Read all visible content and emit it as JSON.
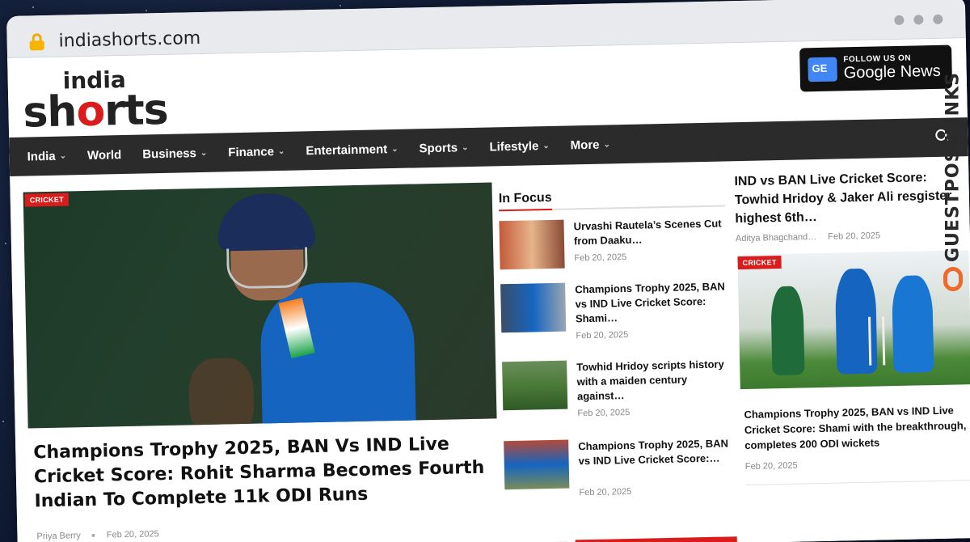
{
  "browser": {
    "url": "indiashorts.com"
  },
  "site": {
    "logo_small": "india",
    "logo_big_pre": "sh",
    "logo_big_red": "o",
    "logo_big_post": "rts",
    "google_news_follow": "FOLLOW US ON",
    "google_news_label": "Google News"
  },
  "nav": {
    "items": [
      {
        "label": "India",
        "caret": true
      },
      {
        "label": "World",
        "caret": false
      },
      {
        "label": "Business",
        "caret": true
      },
      {
        "label": "Finance",
        "caret": true
      },
      {
        "label": "Entertainment",
        "caret": true
      },
      {
        "label": "Sports",
        "caret": true
      },
      {
        "label": "Lifestyle",
        "caret": true
      },
      {
        "label": "More",
        "caret": true
      }
    ]
  },
  "hero": {
    "badge": "CRICKET",
    "title": "Champions Trophy 2025, BAN Vs IND Live Cricket Score: Rohit Sharma Becomes Fourth Indian To Complete 11k ODI Runs",
    "author": "Priya Berry",
    "date": "Feb 20, 2025"
  },
  "in_focus": {
    "heading": "In Focus",
    "items": [
      {
        "title": "Urvashi Rautela’s Scenes Cut from Daaku…",
        "date": "Feb 20, 2025"
      },
      {
        "title": "Champions Trophy 2025, BAN vs IND Live Cricket Score: Shami…",
        "date": "Feb 20, 2025"
      },
      {
        "title": "Towhid Hridoy scripts history with a maiden century against…",
        "date": "Feb 20, 2025"
      },
      {
        "title": "Champions Trophy 2025, BAN vs IND Live Cricket Score:…",
        "date": "Feb 20, 2025"
      }
    ]
  },
  "right": {
    "title": "IND vs BAN Live Cricket Score: Towhid Hridoy & Jaker Ali resgister highest 6th…",
    "author": "Aditya Bhagchand…",
    "date": "Feb 20, 2025",
    "badge": "CRICKET",
    "sub_title": "Champions Trophy 2025, BAN vs IND Live Cricket Score: Shami with the breakthrough, completes 200 ODI wickets",
    "sub_date": "Feb 20, 2025"
  },
  "watermark": {
    "text": "GUESTPOSTLINKS"
  },
  "colors": {
    "accent": "#d91d1d",
    "nav_bg": "#2b2b2b"
  }
}
